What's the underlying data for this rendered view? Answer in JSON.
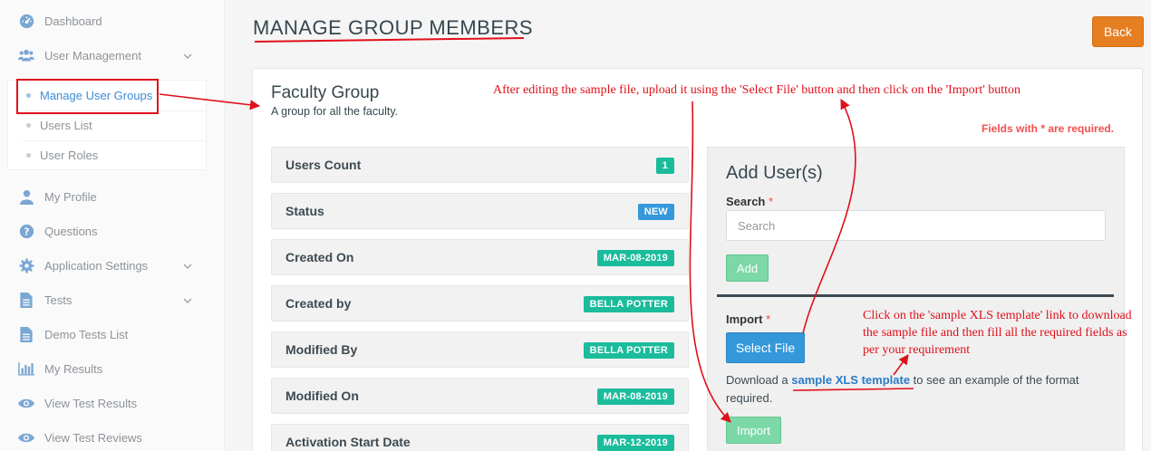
{
  "sidebar": {
    "items": [
      {
        "label": "Dashboard",
        "icon": "dashboard-icon"
      },
      {
        "label": "User Management",
        "icon": "users-icon",
        "expandable": true
      },
      {
        "label": "My Profile",
        "icon": "user-icon"
      },
      {
        "label": "Questions",
        "icon": "question-circle-icon"
      },
      {
        "label": "Application Settings",
        "icon": "gear-icon",
        "expandable": true
      },
      {
        "label": "Tests",
        "icon": "document-icon",
        "expandable": true
      },
      {
        "label": "Demo Tests List",
        "icon": "document-icon"
      },
      {
        "label": "My Results",
        "icon": "bar-chart-icon"
      },
      {
        "label": "View Test Results",
        "icon": "eye-icon"
      },
      {
        "label": "View Test Reviews",
        "icon": "eye-icon"
      }
    ],
    "user_management_sub": [
      {
        "label": "Manage User Groups",
        "active": true
      },
      {
        "label": "Users List",
        "active": false
      },
      {
        "label": "User Roles",
        "active": false
      }
    ]
  },
  "header": {
    "title": "MANAGE GROUP MEMBERS",
    "back_label": "Back"
  },
  "group": {
    "name": "Faculty Group",
    "description": "A group for all the faculty.",
    "required_note": "Fields with * are required."
  },
  "info_rows": [
    {
      "label": "Users Count",
      "badge": "1",
      "badge_color": "#1abc9c"
    },
    {
      "label": "Status",
      "badge": "NEW",
      "badge_color": "#3498db"
    },
    {
      "label": "Created On",
      "badge": "MAR-08-2019",
      "badge_color": "#1abc9c"
    },
    {
      "label": "Created by",
      "badge": "BELLA POTTER",
      "badge_color": "#1abc9c"
    },
    {
      "label": "Modified By",
      "badge": "BELLA POTTER",
      "badge_color": "#1abc9c"
    },
    {
      "label": "Modified On",
      "badge": "MAR-08-2019",
      "badge_color": "#1abc9c"
    },
    {
      "label": "Activation Start Date",
      "badge": "MAR-12-2019",
      "badge_color": "#1abc9c"
    }
  ],
  "add_users": {
    "title": "Add User(s)",
    "search_label": "Search",
    "required_mark": "*",
    "search_placeholder": "Search",
    "search_value": "",
    "add_label": "Add",
    "import_label": "Import",
    "select_file_label": "Select File",
    "download_prefix": "Download a ",
    "download_link": "sample XLS template",
    "download_suffix": " to see an example of the format required.",
    "import_button_label": "Import"
  },
  "annotations": {
    "top": "After editing the sample file, upload it using the 'Select File' button and then click on the 'Import' button",
    "right": "Click on the 'sample XLS template' link to download the sample file and then fill all the required fields as per your requirement"
  },
  "colors": {
    "accent_orange": "#e67e22",
    "primary_blue": "#3498db",
    "badge_teal": "#1abc9c",
    "success_green": "#7dd8a7",
    "annotation_red": "#e0101a",
    "required_red": "#f0504f"
  }
}
